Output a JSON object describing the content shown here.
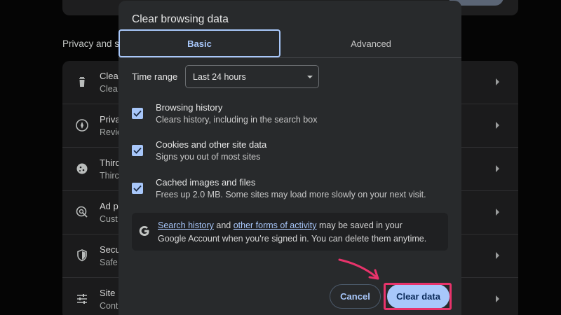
{
  "background": {
    "section_title": "Privacy and s",
    "rows": [
      {
        "icon": "trash-icon",
        "title": "Clea",
        "subtitle": "Clea"
      },
      {
        "icon": "compass-icon",
        "title": "Priva",
        "subtitle": "Revie"
      },
      {
        "icon": "cookie-icon",
        "title": "Thirc",
        "subtitle": "Thirc"
      },
      {
        "icon": "ad-privacy-icon",
        "title": "Ad p",
        "subtitle": "Cust"
      },
      {
        "icon": "shield-icon",
        "title": "Secu",
        "subtitle": "Safe"
      },
      {
        "icon": "sliders-icon",
        "title": "Site",
        "subtitle": "Cont"
      }
    ]
  },
  "dialog": {
    "title": "Clear browsing data",
    "tabs": [
      {
        "label": "Basic",
        "selected": true
      },
      {
        "label": "Advanced",
        "selected": false
      }
    ],
    "time_range": {
      "label": "Time range",
      "value": "Last 24 hours"
    },
    "options": [
      {
        "title": "Browsing history",
        "subtitle": "Clears history, including in the search box",
        "checked": true
      },
      {
        "title": "Cookies and other site data",
        "subtitle": "Signs you out of most sites",
        "checked": true
      },
      {
        "title": "Cached images and files",
        "subtitle": "Frees up 2.0 MB. Some sites may load more slowly on your next visit.",
        "checked": true
      }
    ],
    "google_notice": {
      "icon": "google-g-icon",
      "link1": "Search history",
      "text1": " and ",
      "link2": "other forms of activity",
      "text2": " may be saved in your",
      "line2": "Google Account when you're signed in. You can delete them anytime."
    },
    "buttons": {
      "cancel": "Cancel",
      "clear": "Clear data"
    }
  },
  "colors": {
    "accent": "#a8c7fa",
    "dialog_bg": "#282a2c",
    "annotation": "#e8336b"
  }
}
